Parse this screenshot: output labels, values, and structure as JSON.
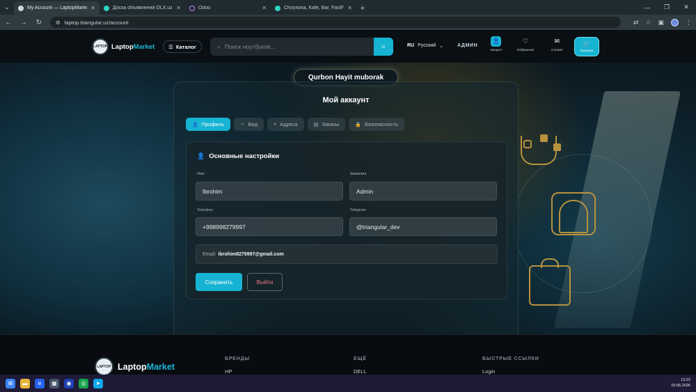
{
  "browser": {
    "tabs": [
      {
        "title": "My Account — LaptopMarket U",
        "active": true,
        "color": "#cfd8dc"
      },
      {
        "title": "Доска объявлений OLX.uz, ро",
        "active": false,
        "color": "#2dd4bf"
      },
      {
        "title": "Odoo",
        "active": false,
        "color": "#c084fc"
      },
      {
        "title": "Choyxona, Kafe, Bar, FastFood",
        "active": false,
        "color": "#2dd4bf"
      }
    ],
    "url": "laptop.triangular.uz/account",
    "new_tab": "+"
  },
  "header": {
    "logo_prefix": "Laptop",
    "logo_suffix": "Market",
    "logo_badge": "LAPTOP",
    "catalog_label": "Каталог",
    "search_placeholder": "Поиск ноутбуков...",
    "lang_code": "RU",
    "lang_name": "Русский",
    "admin_label": "АДМИН",
    "account_label": "Аккаунт",
    "favorites_label": "Избранное",
    "contact_label": "Contact",
    "cart_label": "Корзина"
  },
  "banner": "Qurbon Hayit muborak",
  "account": {
    "title": "Мой аккаунт",
    "tabs": [
      "Профиль",
      "Вид",
      "Адреса",
      "Заказы",
      "Безопасность"
    ],
    "section_title": "Основные настройки",
    "first_name_label": "Имя",
    "first_name": "Ibrohim",
    "last_name_label": "Фамилия",
    "last_name": "Admin",
    "phone_label": "Телефон",
    "phone": "+998998279997",
    "telegram_label": "Telegram",
    "telegram": "@triangular_dev",
    "email_label": "Email:",
    "email": "ibrohim8279997@gmail.com",
    "save_label": "Сохранить",
    "logout_label": "Выйти"
  },
  "footer": {
    "logo_prefix": "Laptop",
    "logo_suffix": "Market",
    "logo_badge": "LAPTOP",
    "brands_title": "БРЕНДЫ",
    "brands_first": "HP",
    "more_title": "ЕЩЁ",
    "more_first": "DELL",
    "quick_title": "БЫСТРЫЕ ССЫЛКИ",
    "quick_first": "Login"
  },
  "taskbar": {
    "time": "13:22",
    "date": "03.06.2026"
  },
  "colors": {
    "accent": "#17b3d2",
    "logout": "#f07a7a",
    "gold": "#b8923e"
  }
}
